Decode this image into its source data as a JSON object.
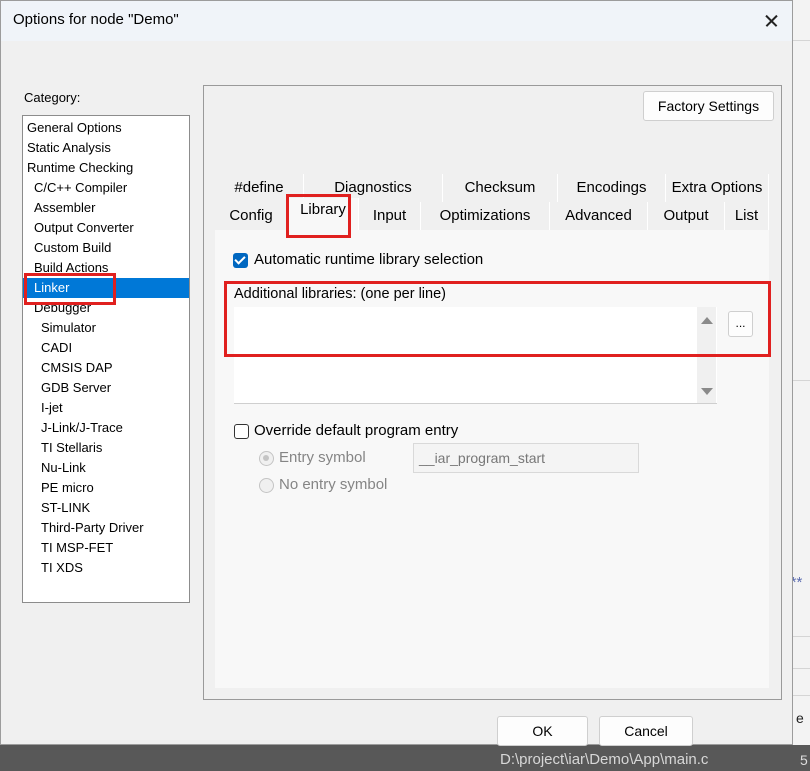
{
  "dialog": {
    "title": "Options for node \"Demo\"",
    "close_icon": "close-icon"
  },
  "category": {
    "label": "Category:",
    "items": [
      {
        "label": "General Options",
        "indent": 0,
        "selected": false
      },
      {
        "label": "Static Analysis",
        "indent": 0,
        "selected": false
      },
      {
        "label": "Runtime Checking",
        "indent": 0,
        "selected": false
      },
      {
        "label": "C/C++ Compiler",
        "indent": 1,
        "selected": false
      },
      {
        "label": "Assembler",
        "indent": 1,
        "selected": false
      },
      {
        "label": "Output Converter",
        "indent": 1,
        "selected": false
      },
      {
        "label": "Custom Build",
        "indent": 1,
        "selected": false
      },
      {
        "label": "Build Actions",
        "indent": 1,
        "selected": false
      },
      {
        "label": "Linker",
        "indent": 1,
        "selected": true
      },
      {
        "label": "Debugger",
        "indent": 1,
        "selected": false
      },
      {
        "label": "Simulator",
        "indent": 2,
        "selected": false
      },
      {
        "label": "CADI",
        "indent": 2,
        "selected": false
      },
      {
        "label": "CMSIS DAP",
        "indent": 2,
        "selected": false
      },
      {
        "label": "GDB Server",
        "indent": 2,
        "selected": false
      },
      {
        "label": "I-jet",
        "indent": 2,
        "selected": false
      },
      {
        "label": "J-Link/J-Trace",
        "indent": 2,
        "selected": false
      },
      {
        "label": "TI Stellaris",
        "indent": 2,
        "selected": false
      },
      {
        "label": "Nu-Link",
        "indent": 2,
        "selected": false
      },
      {
        "label": "PE micro",
        "indent": 2,
        "selected": false
      },
      {
        "label": "ST-LINK",
        "indent": 2,
        "selected": false
      },
      {
        "label": "Third-Party Driver",
        "indent": 2,
        "selected": false
      },
      {
        "label": "TI MSP-FET",
        "indent": 2,
        "selected": false
      },
      {
        "label": "TI XDS",
        "indent": 2,
        "selected": false
      }
    ]
  },
  "factory_settings": "Factory Settings",
  "tabs_row1": [
    "#define",
    "Diagnostics",
    "Checksum",
    "Encodings",
    "Extra Options"
  ],
  "tabs_row2": [
    "Config",
    "Library",
    "Input",
    "Optimizations",
    "Advanced",
    "Output",
    "List"
  ],
  "active_tab": "Library",
  "library": {
    "auto_runtime_label": "Automatic runtime library selection",
    "auto_runtime_checked": true,
    "additional_libraries_label": "Additional libraries: (one per line)",
    "additional_libraries_value": "",
    "browse_label": "...",
    "override_entry_label": "Override default program entry",
    "override_entry_checked": false,
    "entry_symbol_label": "Entry symbol",
    "entry_symbol_value": "__iar_program_start",
    "no_entry_symbol_label": "No entry symbol"
  },
  "buttons": {
    "ok": "OK",
    "cancel": "Cancel"
  },
  "background": {
    "status_path": "D:\\project\\iar\\Demo\\App\\main.c",
    "stars": "**",
    "e": "e",
    "five": "5"
  },
  "colors": {
    "selection": "#0078d7",
    "highlight_red": "#e0201f",
    "checkbox_blue": "#0067c0"
  }
}
